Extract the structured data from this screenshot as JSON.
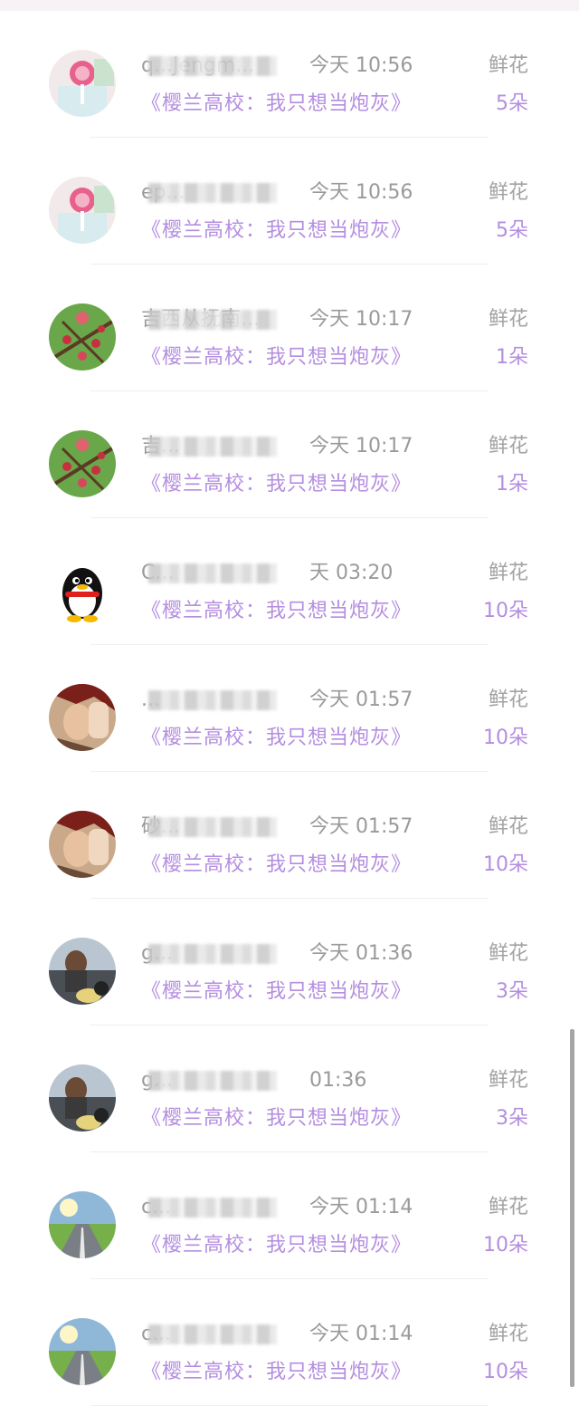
{
  "records": [
    {
      "user": "q...Jengm...",
      "time": "今天 10:56",
      "gift_type": "鲜花",
      "book": "《樱兰高校：我只想当炮灰》",
      "quantity": "5朵",
      "avatar": "lollipop-avatar-icon"
    },
    {
      "user": "ep...",
      "time": "今天 10:56",
      "gift_type": "鲜花",
      "book": "《樱兰高校：我只想当炮灰》",
      "quantity": "5朵",
      "avatar": "lollipop-avatar-icon"
    },
    {
      "user": "吉西从抚南...",
      "time": "今天 10:17",
      "gift_type": "鲜花",
      "book": "《樱兰高校：我只想当炮灰》",
      "quantity": "1朵",
      "avatar": "flower-branch-avatar-icon"
    },
    {
      "user": "吉...",
      "time": "今天 10:17",
      "gift_type": "鲜花",
      "book": "《樱兰高校：我只想当炮灰》",
      "quantity": "1朵",
      "avatar": "flower-branch-avatar-icon"
    },
    {
      "user": "C...",
      "time": "天 03:20",
      "gift_type": "鲜花",
      "book": "《樱兰高校：我只想当炮灰》",
      "quantity": "10朵",
      "avatar": "penguin-avatar-icon"
    },
    {
      "user": "...",
      "time": "今天 01:57",
      "gift_type": "鲜花",
      "book": "《樱兰高校：我只想当炮灰》",
      "quantity": "10朵",
      "avatar": "anime-character-avatar-icon"
    },
    {
      "user": "砂...",
      "time": "今天 01:57",
      "gift_type": "鲜花",
      "book": "《樱兰高校：我只想当炮灰》",
      "quantity": "10朵",
      "avatar": "anime-character-avatar-icon"
    },
    {
      "user": "g...",
      "time": "今天 01:36",
      "gift_type": "鲜花",
      "book": "《樱兰高校：我只想当炮灰》",
      "quantity": "3朵",
      "avatar": "motorcycle-avatar-icon"
    },
    {
      "user": "g...",
      "time": "01:36",
      "gift_type": "鲜花",
      "book": "《樱兰高校：我只想当炮灰》",
      "quantity": "3朵",
      "avatar": "motorcycle-avatar-icon"
    },
    {
      "user": "c...",
      "time": "今天 01:14",
      "gift_type": "鲜花",
      "book": "《樱兰高校：我只想当炮灰》",
      "quantity": "10朵",
      "avatar": "road-landscape-avatar-icon"
    },
    {
      "user": "c...",
      "time": "今天 01:14",
      "gift_type": "鲜花",
      "book": "《樱兰高校：我只想当炮灰》",
      "quantity": "10朵",
      "avatar": "road-landscape-avatar-icon"
    }
  ],
  "colors": {
    "accent": "#b48ee0",
    "muted": "#9a9a9a"
  }
}
